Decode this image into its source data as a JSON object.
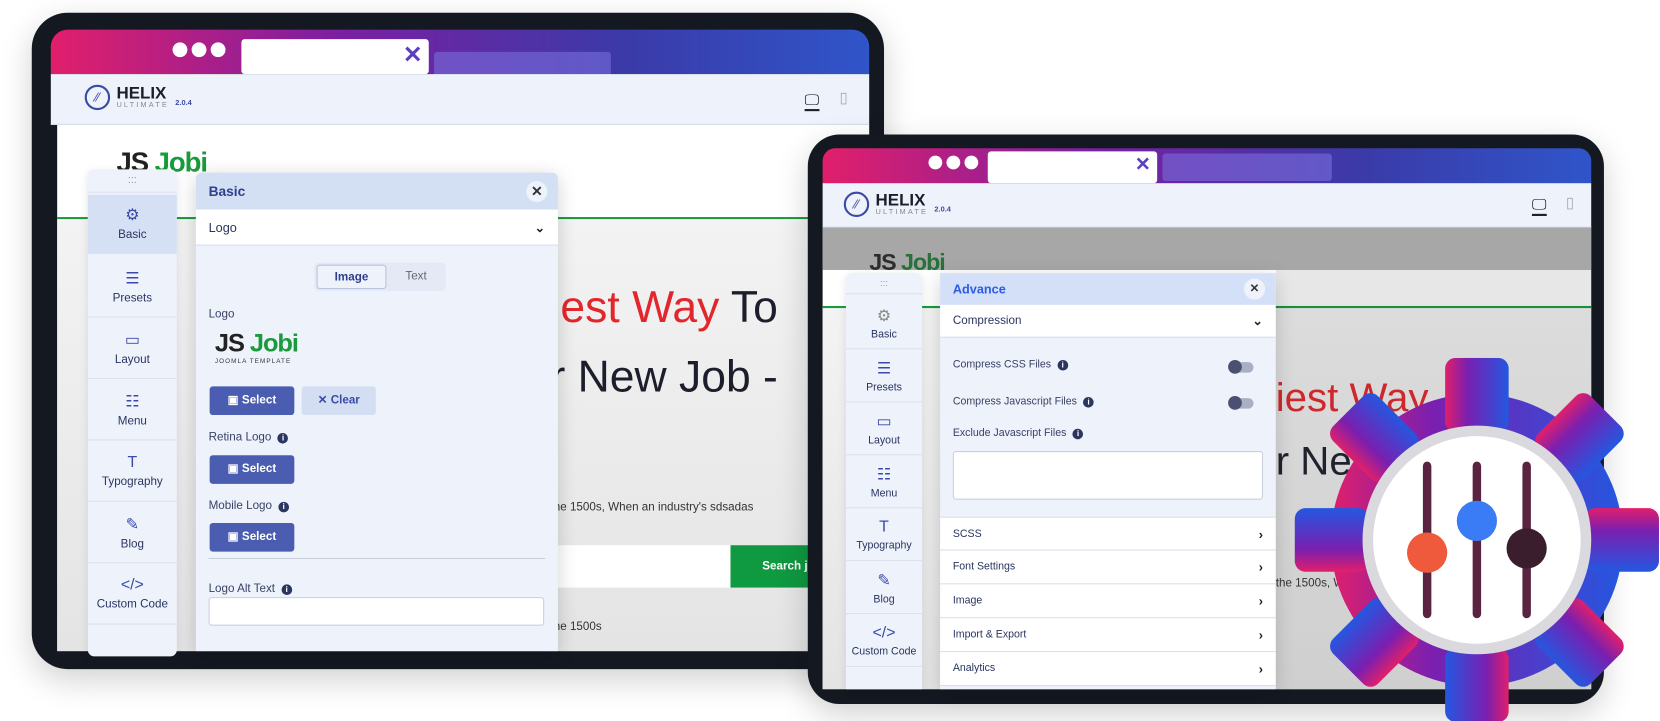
{
  "colors": {
    "accent": "#4a5db0",
    "brand_green": "#1a9b3b",
    "hero_red": "#e3262b",
    "gradient_start": "#e11f6b",
    "gradient_end": "#2f55c9",
    "advance_title": "#2d5be3"
  },
  "helix": {
    "name": "HELIX",
    "subtitle": "ULTIMATE",
    "version": "2.0.4"
  },
  "tab_close": "✕",
  "site_logo": {
    "prefix": "JS",
    "name": "Jobi",
    "tagline": "JOOMLA TEMPLATE"
  },
  "hero": {
    "line1_red": "iest Way",
    "line1_black": " To",
    "line2": "r New Job -",
    "paragraph": "the 1500s, When an industry's sdsadas",
    "search_button": "Search j",
    "paragraph2": "the 1500s"
  },
  "hero_right": {
    "line1_red": "iest Way",
    "line2": "r Ne",
    "paragraph": "the 1500s, W"
  },
  "sidebar": {
    "handle": ":::",
    "items": [
      {
        "label": "Basic",
        "icon": "gear-icon",
        "glyph": "⚙"
      },
      {
        "label": "Presets",
        "icon": "sliders-icon",
        "glyph": "☰"
      },
      {
        "label": "Layout",
        "icon": "layout-icon",
        "glyph": "▭"
      },
      {
        "label": "Menu",
        "icon": "menu-list-icon",
        "glyph": "☷"
      },
      {
        "label": "Typography",
        "icon": "typography-icon",
        "glyph": "T"
      },
      {
        "label": "Blog",
        "icon": "blog-icon",
        "glyph": "✎"
      },
      {
        "label": "Custom Code",
        "icon": "code-icon",
        "glyph": "</>"
      }
    ]
  },
  "basic_panel": {
    "title": "Basic",
    "close": "✕",
    "section": "Logo",
    "chevron": "⌄",
    "segments": [
      "Image",
      "Text"
    ],
    "active_segment": "Image",
    "logo_label": "Logo",
    "select": "Select",
    "clear": "✕ Clear",
    "retina_label": "Retina Logo",
    "mobile_label": "Mobile Logo",
    "alt_label": "Logo Alt Text",
    "alt_value": ""
  },
  "advance_panel": {
    "title": "Advance",
    "close": "✕",
    "section": "Compression",
    "chevron": "⌄",
    "fields": [
      {
        "label": "Compress CSS Files",
        "toggle": false
      },
      {
        "label": "Compress Javascript Files",
        "toggle": false
      }
    ],
    "exclude_label": "Exclude Javascript Files",
    "exclude_value": "",
    "sections": [
      "SCSS",
      "Font Settings",
      "Image",
      "Import & Export",
      "Analytics"
    ]
  },
  "gear": {
    "icon": "settings-sliders-gear-icon",
    "knob_colors": [
      "#f05a3c",
      "#3a7cf5",
      "#3a1e2e"
    ]
  }
}
